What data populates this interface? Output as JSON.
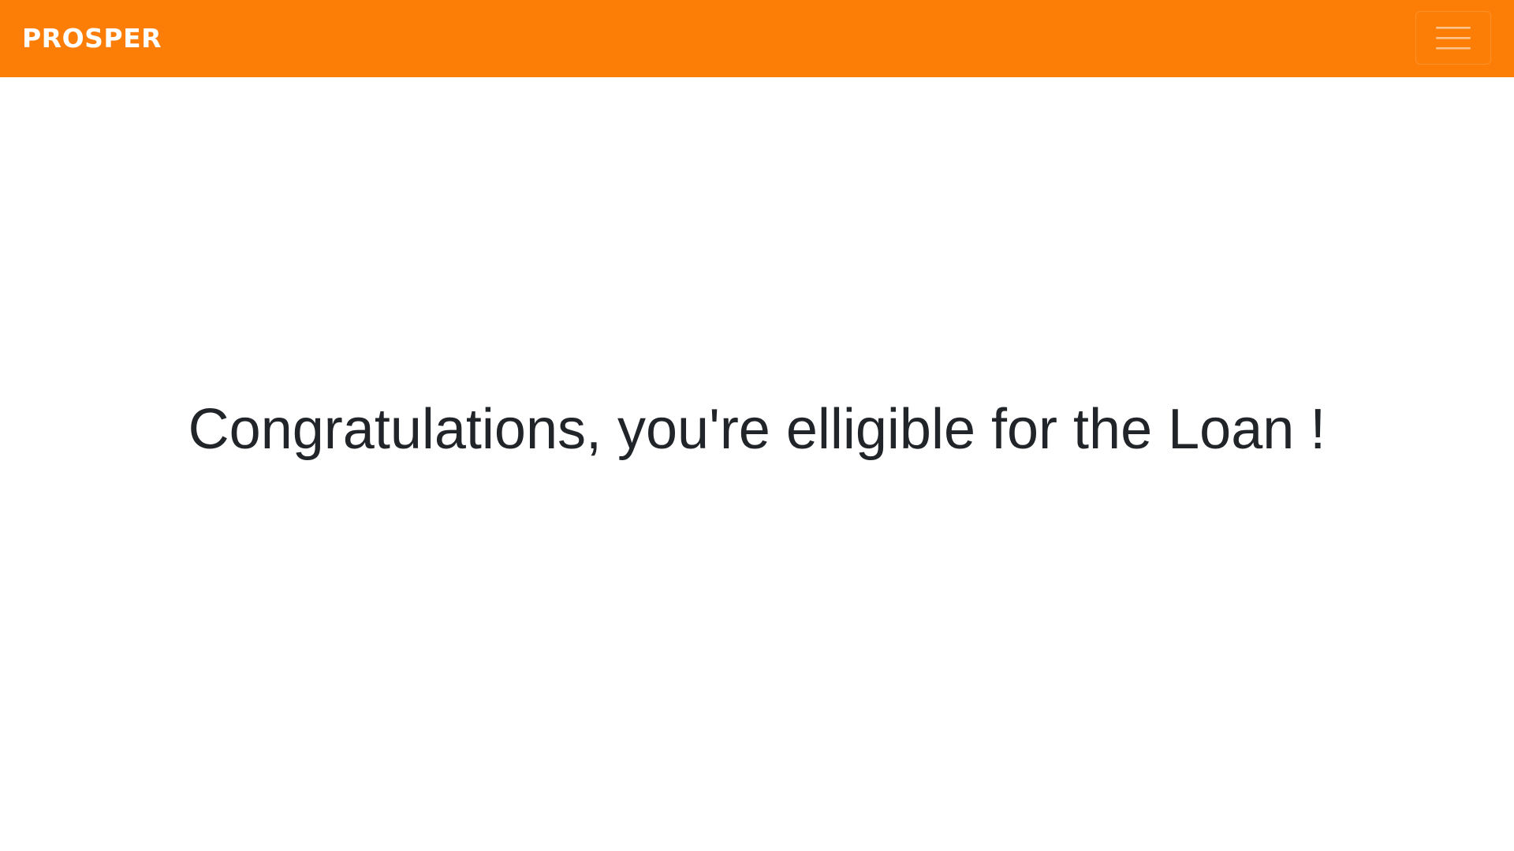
{
  "navbar": {
    "brand": "PROSPER",
    "background_color": "#fd7e07",
    "toggler_icon": "hamburger-menu-icon"
  },
  "main": {
    "message": "Congratulations, you're elligible for the Loan !",
    "text_color": "#212529"
  }
}
